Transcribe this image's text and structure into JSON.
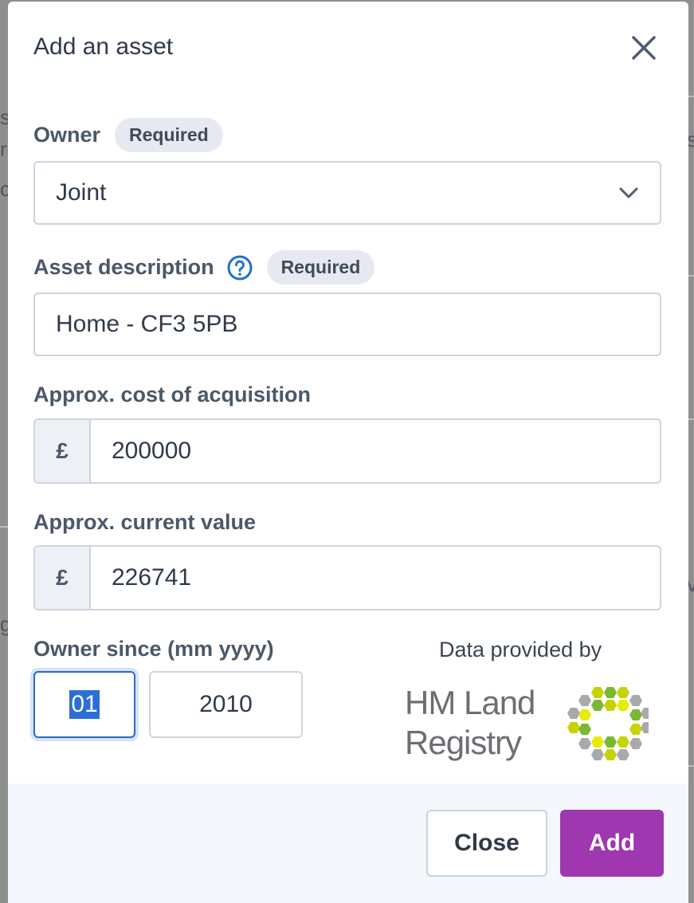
{
  "modal": {
    "title": "Add an asset",
    "close_icon": "close-icon"
  },
  "owner": {
    "label": "Owner",
    "required_badge": "Required",
    "selected_value": "Joint",
    "dropdown_icon": "chevron-down-icon"
  },
  "asset_description": {
    "label": "Asset description",
    "help_icon": "question-circle-icon",
    "required_badge": "Required",
    "value": "Home - CF3 5PB"
  },
  "acquisition_cost": {
    "label": "Approx. cost of acquisition",
    "currency_prefix": "£",
    "value": "200000"
  },
  "current_value": {
    "label": "Approx. current value",
    "currency_prefix": "£",
    "value": "226741"
  },
  "owner_since": {
    "label": "Owner since (mm yyyy)",
    "month": "01",
    "year": "2010"
  },
  "data_provider": {
    "caption": "Data provided by",
    "name_line1": "HM Land",
    "name_line2": "Registry",
    "logo_icon": "hm-land-registry-logo"
  },
  "footer": {
    "close_label": "Close",
    "add_label": "Add"
  },
  "colors": {
    "accent_button": "#9f37b0",
    "focus_border": "#2b69c9",
    "help_icon": "#1f6fd0"
  }
}
